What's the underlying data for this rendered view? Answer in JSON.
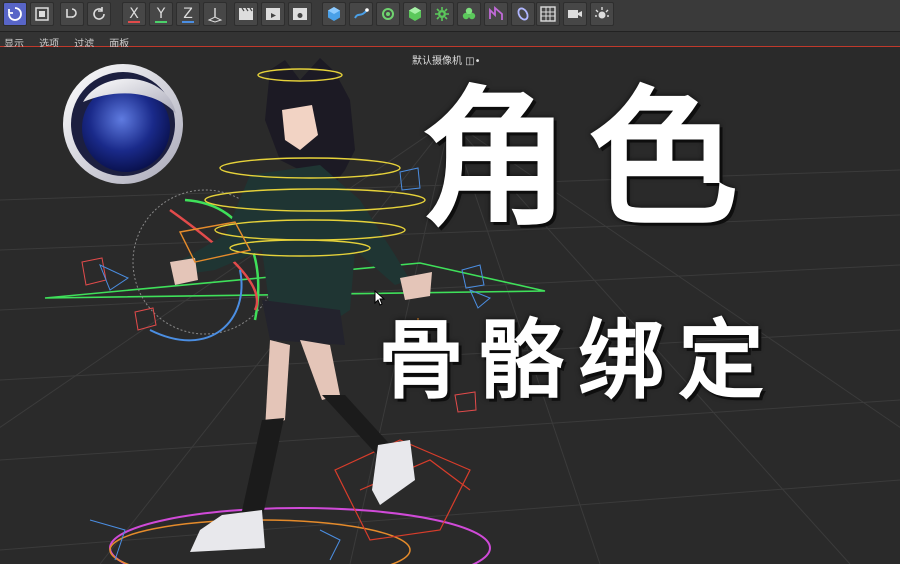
{
  "toolbar": {
    "axes": [
      {
        "label": "X",
        "color": "#e24b4b"
      },
      {
        "label": "Y",
        "color": "#4bd16a"
      },
      {
        "label": "Z",
        "color": "#4b8ee2"
      }
    ]
  },
  "menu": [
    "显示",
    "选项",
    "过滤",
    "面板"
  ],
  "viewport": {
    "camera_label": "默认摄像机 ◫•",
    "title_main": "角色",
    "title_sub": "骨骼绑定"
  },
  "colors": {
    "accent": "#5865c7",
    "menu_underline": "#c0392b",
    "grid": "#3b3b3b"
  },
  "icons": [
    "undo-icon",
    "scale-icon",
    "rotate-undo-icon",
    "refresh-icon",
    "coordinate-icon",
    "clapper-icon",
    "play-icon",
    "render-settings-icon",
    "cube-icon",
    "spline-icon",
    "generator-icon",
    "deformer-icon",
    "gear-icon",
    "mograph-icon",
    "field-icon",
    "tag-icon",
    "grid-icon",
    "camera-icon",
    "light-icon"
  ]
}
